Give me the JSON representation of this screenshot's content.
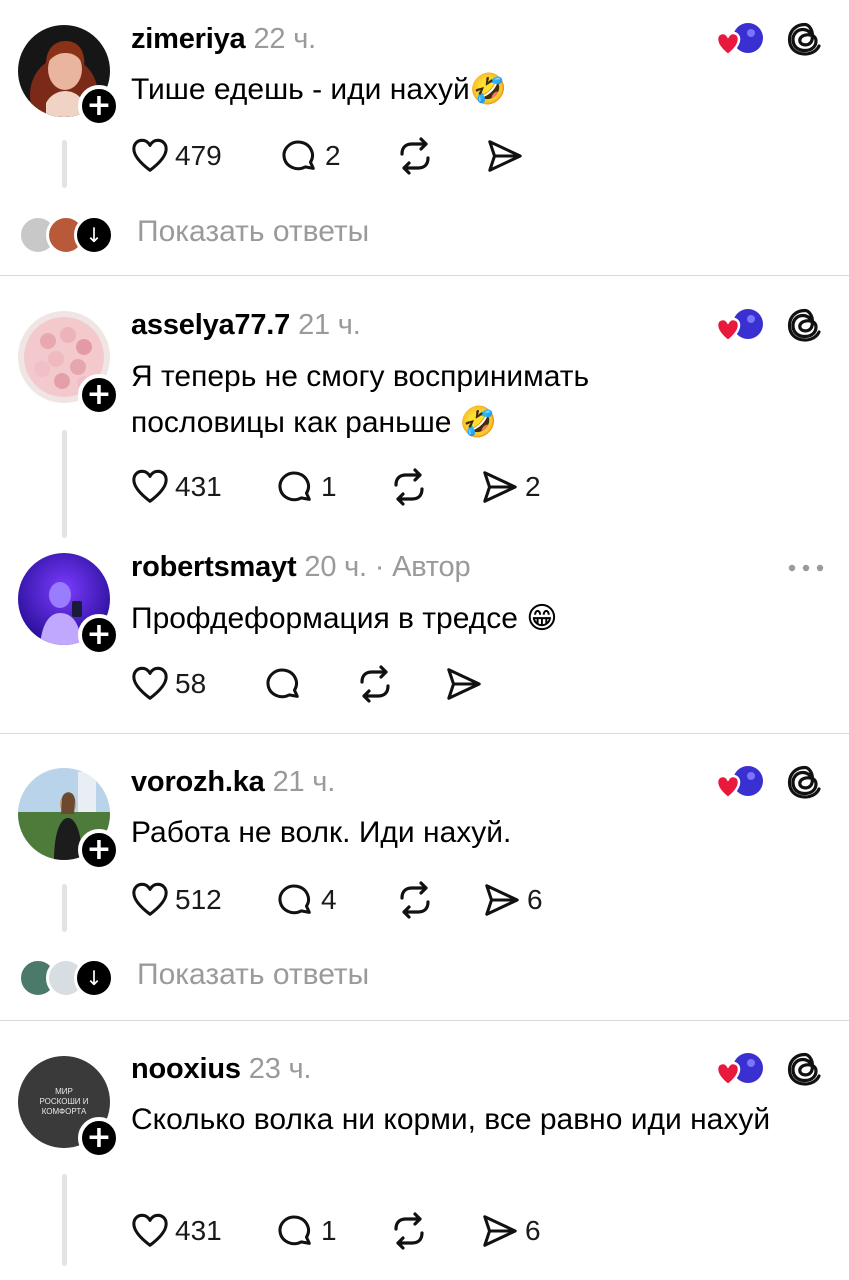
{
  "posts": [
    {
      "username": "zimeriya",
      "time": "22 ч.",
      "text": "Тише едешь - иди нахуй🤣",
      "likes": "479",
      "comments": "2",
      "reposts": "",
      "shares": "",
      "show_replies": "Показать ответы"
    },
    {
      "username": "asselya77.7",
      "time": "21 ч.",
      "text": "Я теперь не смогу воспринимать пословицы как раньше 🤣",
      "likes": "431",
      "comments": "1",
      "reposts": "",
      "shares": "2"
    },
    {
      "username": "robertsmayt",
      "time": "20 ч. · Автор",
      "text": "Профдеформация в тредсе 😁",
      "likes": "58",
      "comments": "",
      "reposts": "",
      "shares": ""
    },
    {
      "username": "vorozh.ka",
      "time": "21 ч.",
      "text": "Работа не волк. Иди нахуй.",
      "likes": "512",
      "comments": "4",
      "reposts": "",
      "shares": "6",
      "show_replies": "Показать ответы"
    },
    {
      "username": "nooxius",
      "time": "23 ч.",
      "text": "Сколько волка ни корми, все равно иди нахуй",
      "likes": "431",
      "comments": "1",
      "reposts": "",
      "shares": "6",
      "avatar_text": "МИР РОСКОШИ И КОМФОРТА"
    }
  ],
  "icons": {
    "like": "heart-icon",
    "comment": "comment-bubble-icon",
    "repost": "repost-icon",
    "share": "send-icon",
    "reaction": "liked-by-avatars-icon",
    "threads": "threads-logo-icon",
    "more": "more-options-icon",
    "plus": "follow-plus-icon"
  },
  "colors": {
    "background": "#ffffff",
    "muted": "#9a9a9a",
    "heart_red": "#e8193c",
    "divider": "#dadada"
  }
}
